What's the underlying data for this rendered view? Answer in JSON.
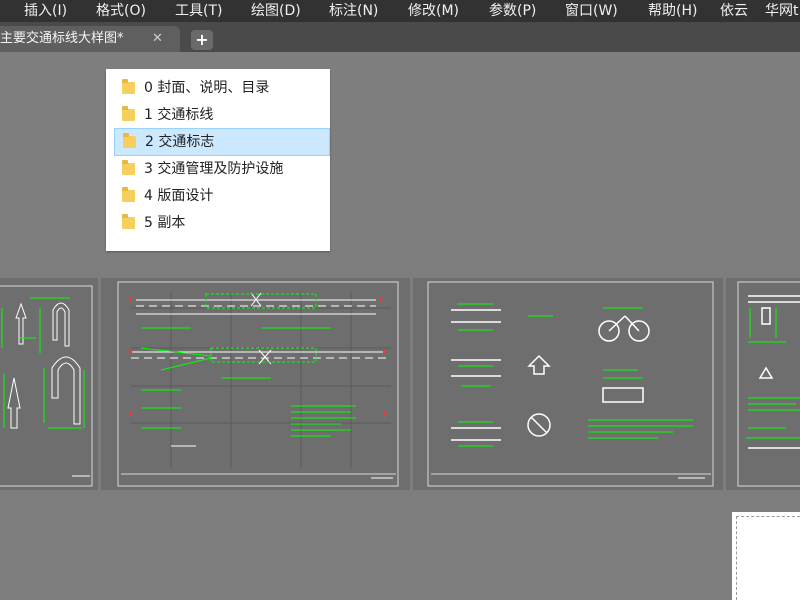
{
  "menu": [
    {
      "label": "插入(I)"
    },
    {
      "label": "格式(O)"
    },
    {
      "label": "工具(T)"
    },
    {
      "label": "绘图(D)"
    },
    {
      "label": "标注(N)"
    },
    {
      "label": "修改(M)"
    },
    {
      "label": "参数(P)"
    },
    {
      "label": "窗口(W)"
    },
    {
      "label": "帮助(H)"
    },
    {
      "label": "依云"
    },
    {
      "label": "华网t"
    }
  ],
  "tab": {
    "title": "主要交通标线大样图*",
    "close": "✕",
    "new_tab": "+"
  },
  "folder_panel": {
    "items": [
      {
        "label": "0 封面、说明、目录"
      },
      {
        "label": "1 交通标线"
      },
      {
        "label": "2 交通标志",
        "selected": true
      },
      {
        "label": "3 交通管理及防护设施"
      },
      {
        "label": "4 版面设计"
      },
      {
        "label": "5 副本"
      }
    ]
  },
  "colors": {
    "menubar": "#323232",
    "tabbar": "#4a4a4a",
    "canvas": "#7e7e7e",
    "sheet": "#6e6e6e",
    "cad_green": "#00ff00",
    "selection": "#cce8ff"
  },
  "icons": {
    "folder": "folder-icon",
    "close": "close-icon",
    "plus": "plus-icon"
  }
}
